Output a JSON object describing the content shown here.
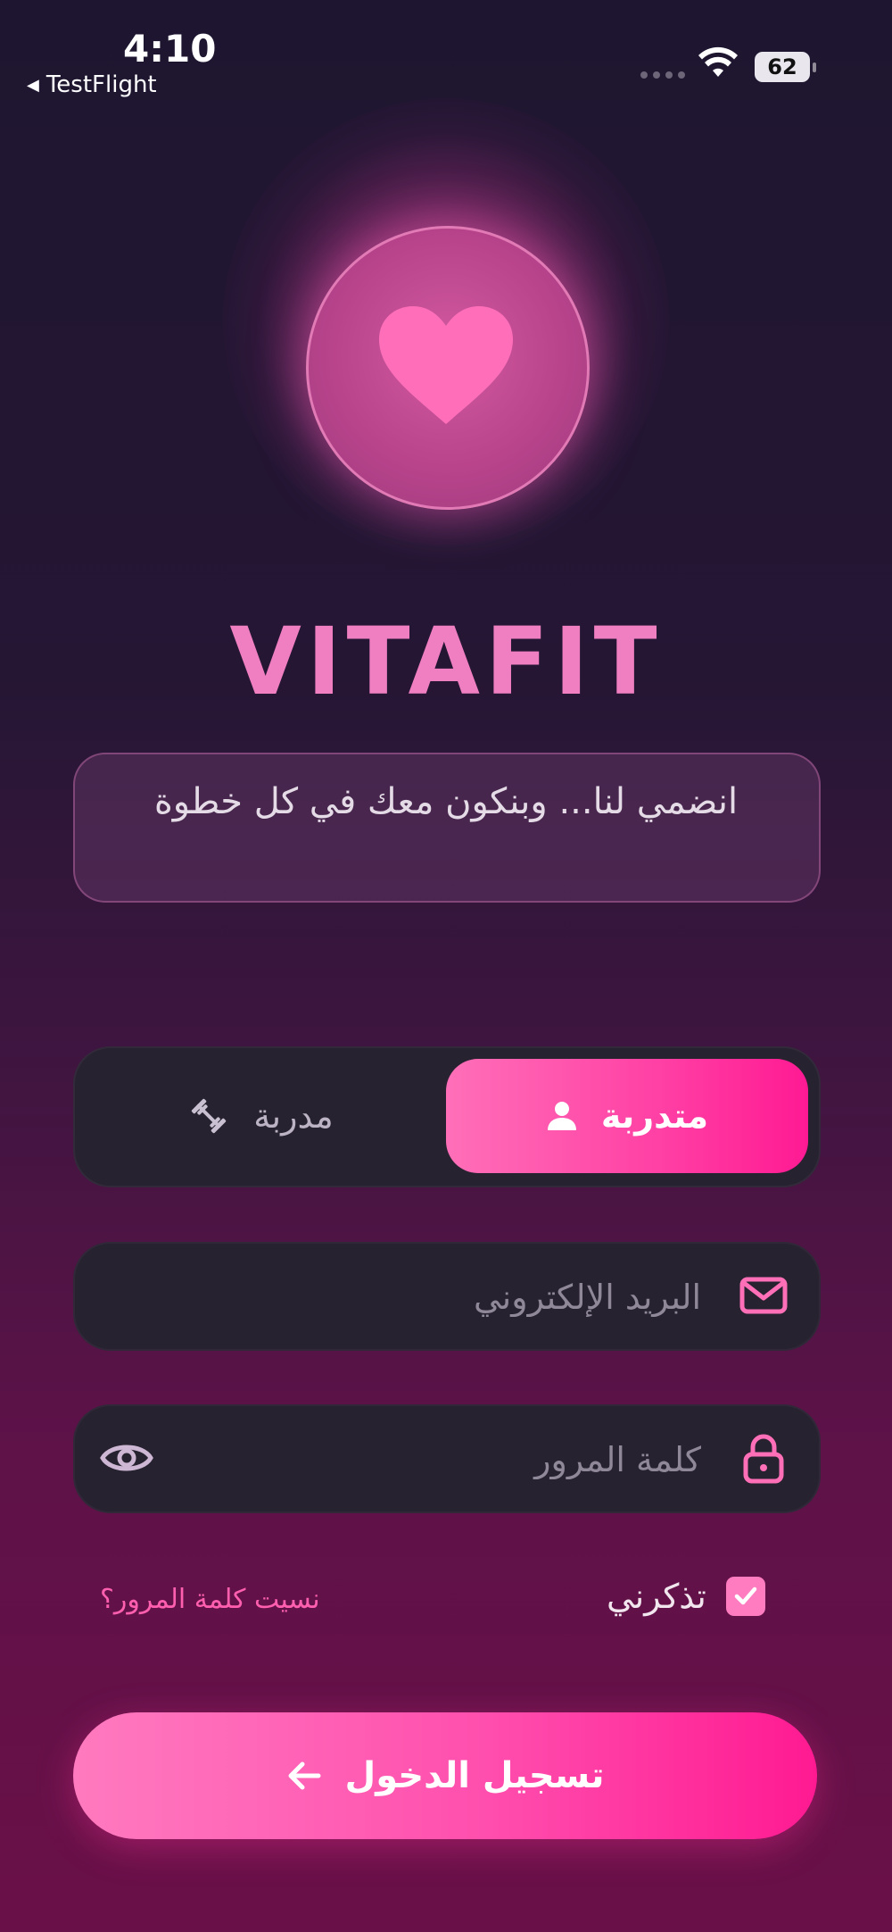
{
  "status_bar": {
    "time": "4:10",
    "back_app": "TestFlight",
    "battery": "62"
  },
  "brand": {
    "name": "VITAFIT",
    "tagline": "انضمي لنا... وبنكون معك في كل خطوة"
  },
  "role_toggle": {
    "active_label": "متدربة",
    "inactive_label": "مدربة"
  },
  "form": {
    "email_placeholder": "البريد الإلكتروني",
    "password_placeholder": "كلمة المرور",
    "remember_label": "تذكرني",
    "remember_checked": true,
    "forgot_label": "نسيت كلمة المرور؟",
    "login_label": "تسجيل الدخول"
  },
  "colors": {
    "accent": "#ff3fa4",
    "accent_light": "#ff7cc0",
    "field_bg": "#26222f"
  },
  "icons": [
    "heart-icon",
    "user-icon",
    "dumbbell-icon",
    "mail-icon",
    "lock-icon",
    "eye-icon",
    "check-icon",
    "arrow-left-icon",
    "wifi-icon"
  ]
}
